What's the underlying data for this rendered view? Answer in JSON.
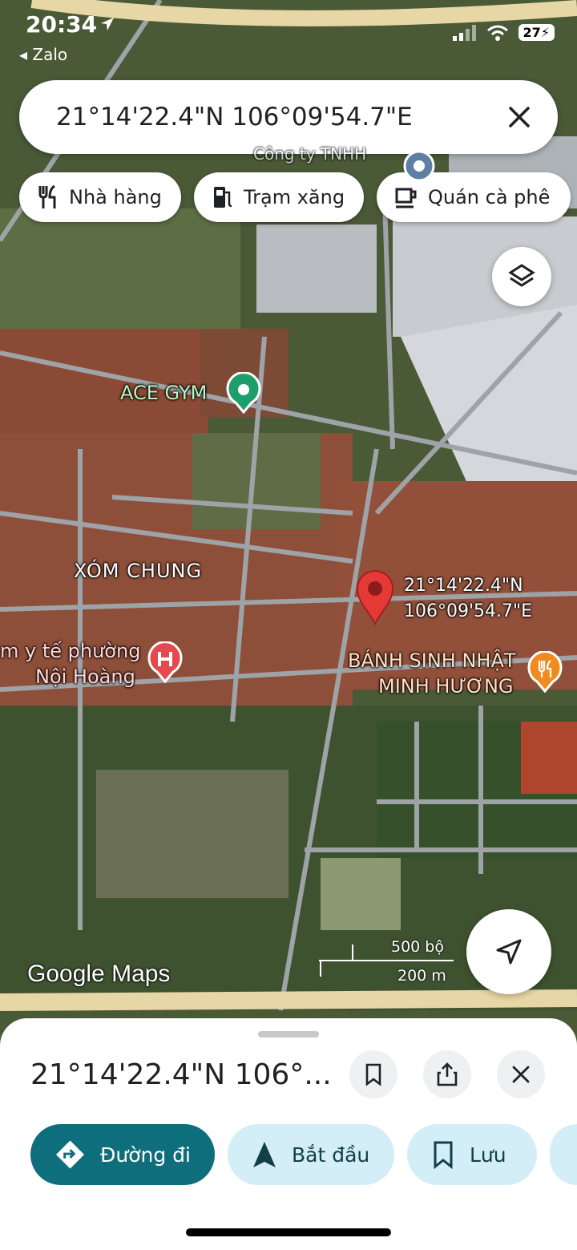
{
  "status_bar": {
    "time": "20:34",
    "back_app": "Zalo",
    "battery": "27"
  },
  "search": {
    "query": "21°14'22.4\"N 106°09'54.7\"E"
  },
  "chips": [
    {
      "label": "Nhà hàng",
      "icon": "restaurant-icon"
    },
    {
      "label": "Trạm xăng",
      "icon": "gas-station-icon"
    },
    {
      "label": "Quán cà phê",
      "icon": "coffee-icon"
    }
  ],
  "map": {
    "places": {
      "gym": "ACE GYM",
      "neighborhood": "XÓM CHUNG",
      "clinic_line1": "m y tế phường",
      "clinic_line2": "Nội Hoàng",
      "bakery_line1": "BÁNH SINH NHẬT",
      "bakery_line2": "MINH HƯƠNG",
      "company": "Công ty TNHH"
    },
    "pin": {
      "lat": "21°14'22.4\"N",
      "lng": "106°09'54.7\"E"
    },
    "logo": "Google Maps",
    "scale_imperial": "500 bộ",
    "scale_metric": "200 m"
  },
  "sheet": {
    "title": "21°14'22.4\"N 106°...",
    "actions": {
      "directions": "Đường đi",
      "start": "Bắt đầu",
      "save": "Lưu"
    }
  },
  "colors": {
    "primary": "#0f6e7b",
    "secondary": "#d3eef6",
    "pin": "#e53935",
    "gym_marker": "#1e9e6a",
    "hospital_marker": "#e5484d",
    "food_marker": "#f28b1f"
  }
}
